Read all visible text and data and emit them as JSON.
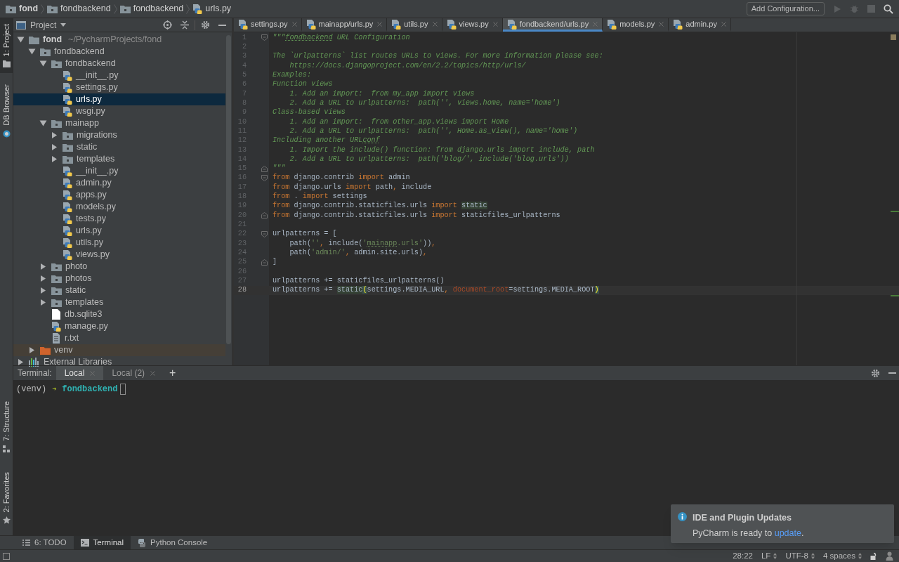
{
  "breadcrumbs": [
    {
      "label": "fond",
      "kind": "folder",
      "bold": true
    },
    {
      "label": "fondbackend",
      "kind": "module",
      "bold": false
    },
    {
      "label": "fondbackend",
      "kind": "module",
      "bold": false
    },
    {
      "label": "urls.py",
      "kind": "python",
      "bold": false
    }
  ],
  "toolbar": {
    "run_configuration": "Add Configuration..."
  },
  "left_tool_strip": {
    "top": [
      {
        "label": "1: Project",
        "kind": "project",
        "selected": true
      },
      {
        "label": "DB Browser",
        "kind": "db",
        "selected": false
      }
    ],
    "bottom": [
      {
        "label": "7: Structure",
        "kind": "structure",
        "selected": false
      },
      {
        "label": "2: Favorites",
        "kind": "favorites",
        "selected": false
      }
    ]
  },
  "project_panel": {
    "title": "Project",
    "tree": [
      {
        "label": "fond",
        "path": "~/PycharmProjects/fond",
        "kind": "root",
        "expanded": true,
        "selected": false,
        "children": [
          {
            "label": "fondbackend",
            "kind": "folder",
            "expanded": true,
            "selected": false,
            "children": [
              {
                "label": "fondbackend",
                "kind": "folder",
                "expanded": true,
                "selected": false,
                "children": [
                  {
                    "label": "__init__.py",
                    "kind": "python",
                    "selected": false
                  },
                  {
                    "label": "settings.py",
                    "kind": "python",
                    "selected": false
                  },
                  {
                    "label": "urls.py",
                    "kind": "python",
                    "selected": true
                  },
                  {
                    "label": "wsgi.py",
                    "kind": "python",
                    "selected": false
                  }
                ]
              },
              {
                "label": "mainapp",
                "kind": "folder",
                "expanded": true,
                "selected": false,
                "children": [
                  {
                    "label": "migrations",
                    "kind": "folder",
                    "expanded": false,
                    "selected": false
                  },
                  {
                    "label": "static",
                    "kind": "folder",
                    "expanded": false,
                    "selected": false
                  },
                  {
                    "label": "templates",
                    "kind": "folder",
                    "expanded": false,
                    "selected": false
                  },
                  {
                    "label": "__init__.py",
                    "kind": "python",
                    "selected": false
                  },
                  {
                    "label": "admin.py",
                    "kind": "python",
                    "selected": false
                  },
                  {
                    "label": "apps.py",
                    "kind": "python",
                    "selected": false
                  },
                  {
                    "label": "models.py",
                    "kind": "python",
                    "selected": false
                  },
                  {
                    "label": "tests.py",
                    "kind": "python",
                    "selected": false
                  },
                  {
                    "label": "urls.py",
                    "kind": "python",
                    "selected": false
                  },
                  {
                    "label": "utils.py",
                    "kind": "python",
                    "selected": false
                  },
                  {
                    "label": "views.py",
                    "kind": "python",
                    "selected": false
                  }
                ]
              },
              {
                "label": "photo",
                "kind": "folder",
                "expanded": false,
                "selected": false
              },
              {
                "label": "photos",
                "kind": "folder",
                "expanded": false,
                "selected": false
              },
              {
                "label": "static",
                "kind": "folder",
                "expanded": false,
                "selected": false
              },
              {
                "label": "templates",
                "kind": "folder",
                "expanded": false,
                "selected": false
              },
              {
                "label": "db.sqlite3",
                "kind": "file",
                "selected": false
              },
              {
                "label": "manage.py",
                "kind": "python",
                "selected": false
              },
              {
                "label": "r.txt",
                "kind": "text",
                "selected": false
              }
            ]
          },
          {
            "label": "venv",
            "kind": "excluded",
            "expanded": false,
            "selected": false
          }
        ]
      },
      {
        "label": "External Libraries",
        "kind": "library",
        "expanded": false,
        "selected": false
      }
    ]
  },
  "editor_tabs": [
    {
      "label": "settings.py",
      "selected": false
    },
    {
      "label": "mainapp/urls.py",
      "selected": false
    },
    {
      "label": "utils.py",
      "selected": false
    },
    {
      "label": "views.py",
      "selected": false
    },
    {
      "label": "fondbackend/urls.py",
      "selected": true
    },
    {
      "label": "models.py",
      "selected": false
    },
    {
      "label": "admin.py",
      "selected": false
    }
  ],
  "editor": {
    "lines": [
      {
        "number": "1",
        "fold_start": true,
        "current": false,
        "tokens": [
          {
            "kind": "doc",
            "text": "\"\"\""
          },
          {
            "kind": "doc_marked",
            "text": "fondbackend"
          },
          {
            "kind": "doc",
            "text": " URL Configuration"
          }
        ]
      },
      {
        "number": "2",
        "current": false
      },
      {
        "number": "3",
        "current": false,
        "tokens": [
          {
            "kind": "doc",
            "text": "The `urlpatterns` list routes URLs to views. For more information please see:"
          }
        ]
      },
      {
        "number": "4",
        "current": false,
        "tokens": [
          {
            "kind": "doc",
            "text": "    https://docs.djangoproject.com/en/2.2/topics/http/urls/"
          }
        ]
      },
      {
        "number": "5",
        "current": false,
        "tokens": [
          {
            "kind": "doc",
            "text": "Examples:"
          }
        ]
      },
      {
        "number": "6",
        "current": false,
        "tokens": [
          {
            "kind": "doc",
            "text": "Function views"
          }
        ]
      },
      {
        "number": "7",
        "current": false,
        "tokens": [
          {
            "kind": "doc",
            "text": "    1. Add an import:  from my_app import views"
          }
        ]
      },
      {
        "number": "8",
        "current": false,
        "tokens": [
          {
            "kind": "doc",
            "text": "    2. Add a URL to urlpatterns:  path('', views.home, name='home')"
          }
        ]
      },
      {
        "number": "9",
        "current": false,
        "tokens": [
          {
            "kind": "doc",
            "text": "Class-based views"
          }
        ]
      },
      {
        "number": "10",
        "current": false,
        "tokens": [
          {
            "kind": "doc",
            "text": "    1. Add an import:  from other_app.views import Home"
          }
        ]
      },
      {
        "number": "11",
        "current": false,
        "tokens": [
          {
            "kind": "doc",
            "text": "    2. Add a URL to urlpatterns:  path('', Home.as_view(), name='home')"
          }
        ]
      },
      {
        "number": "12",
        "current": false,
        "tokens": [
          {
            "kind": "doc",
            "text": "Including another URL"
          },
          {
            "kind": "doc_marked",
            "text": "conf"
          }
        ]
      },
      {
        "number": "13",
        "current": false,
        "tokens": [
          {
            "kind": "doc",
            "text": "    1. Import the include() function: from django.urls import include, path"
          }
        ]
      },
      {
        "number": "14",
        "current": false,
        "tokens": [
          {
            "kind": "doc",
            "text": "    2. Add a URL to urlpatterns:  path('blog/', include('blog.urls'))"
          }
        ]
      },
      {
        "number": "15",
        "fold_end": true,
        "current": false,
        "tokens": [
          {
            "kind": "doc",
            "text": "\"\"\""
          }
        ]
      },
      {
        "number": "16",
        "fold_start": true,
        "current": false,
        "tokens": [
          {
            "kind": "keyword",
            "text": "from"
          },
          {
            "kind": "plain",
            "text": " django.contrib "
          },
          {
            "kind": "keyword",
            "text": "import"
          },
          {
            "kind": "plain",
            "text": " admin"
          }
        ]
      },
      {
        "number": "17",
        "current": false,
        "tokens": [
          {
            "kind": "keyword",
            "text": "from"
          },
          {
            "kind": "plain",
            "text": " django.urls "
          },
          {
            "kind": "keyword",
            "text": "import"
          },
          {
            "kind": "plain",
            "text": " path"
          },
          {
            "kind": "keyword",
            "text": ","
          },
          {
            "kind": "plain",
            "text": " include"
          }
        ]
      },
      {
        "number": "18",
        "current": false,
        "tokens": [
          {
            "kind": "keyword",
            "text": "from"
          },
          {
            "kind": "plain",
            "text": " . "
          },
          {
            "kind": "keyword",
            "text": "import"
          },
          {
            "kind": "plain",
            "text": " settings"
          }
        ]
      },
      {
        "number": "19",
        "current": false,
        "tokens": [
          {
            "kind": "keyword",
            "text": "from"
          },
          {
            "kind": "plain",
            "text": " django.contrib.staticfiles.urls "
          },
          {
            "kind": "keyword",
            "text": "import "
          },
          {
            "kind": "usage",
            "text": "static"
          }
        ]
      },
      {
        "number": "20",
        "fold_end": true,
        "current": false,
        "tokens": [
          {
            "kind": "keyword",
            "text": "from"
          },
          {
            "kind": "plain",
            "text": " django.contrib.staticfiles.urls "
          },
          {
            "kind": "keyword",
            "text": "import"
          },
          {
            "kind": "plain",
            "text": " staticfiles_urlpatterns"
          }
        ]
      },
      {
        "number": "21",
        "current": false
      },
      {
        "number": "22",
        "fold_start": true,
        "current": false,
        "tokens": [
          {
            "kind": "plain",
            "text": "urlpatterns = ["
          }
        ]
      },
      {
        "number": "23",
        "current": false,
        "tokens": [
          {
            "kind": "plain",
            "text": "    path("
          },
          {
            "kind": "string",
            "text": "''"
          },
          {
            "kind": "keyword",
            "text": ", "
          },
          {
            "kind": "plain",
            "text": "include("
          },
          {
            "kind": "string",
            "text": "'"
          },
          {
            "kind": "string_marked",
            "text": "mainapp"
          },
          {
            "kind": "string",
            "text": ".urls'"
          },
          {
            "kind": "plain",
            "text": "))"
          },
          {
            "kind": "keyword",
            "text": ","
          }
        ]
      },
      {
        "number": "24",
        "current": false,
        "tokens": [
          {
            "kind": "plain",
            "text": "    path("
          },
          {
            "kind": "string",
            "text": "'admin/'"
          },
          {
            "kind": "keyword",
            "text": ", "
          },
          {
            "kind": "plain",
            "text": "admin.site.urls)"
          },
          {
            "kind": "keyword",
            "text": ","
          }
        ]
      },
      {
        "number": "25",
        "fold_end": true,
        "current": false,
        "tokens": [
          {
            "kind": "plain",
            "text": "]"
          }
        ]
      },
      {
        "number": "26",
        "current": false
      },
      {
        "number": "27",
        "current": false,
        "tokens": [
          {
            "kind": "plain",
            "text": "urlpatterns += staticfiles_urlpatterns()"
          }
        ]
      },
      {
        "number": "28",
        "current": true,
        "tokens": [
          {
            "kind": "plain",
            "text": "urlpatterns += "
          },
          {
            "kind": "usage",
            "text": "static"
          },
          {
            "kind": "brace",
            "text": "("
          },
          {
            "kind": "plain",
            "text": "settings.MEDIA_URL"
          },
          {
            "kind": "keyword",
            "text": ", "
          },
          {
            "kind": "param",
            "text": "document_root"
          },
          {
            "kind": "plain",
            "text": "=settings.MEDIA_ROOT"
          },
          {
            "kind": "brace",
            "text": ")"
          }
        ]
      }
    ]
  },
  "terminal": {
    "label": "Terminal:",
    "tabs": [
      {
        "label": "Local",
        "selected": true
      },
      {
        "label": "Local (2)",
        "selected": false
      }
    ],
    "new_tab": "+",
    "prompt": {
      "env": "(venv)",
      "arrow": "➜",
      "directory": "fondbackend"
    }
  },
  "bottom_tool_tabs": [
    {
      "label": "6: TODO",
      "kind": "todo",
      "selected": false
    },
    {
      "label": "Terminal",
      "kind": "terminal",
      "selected": true
    },
    {
      "label": "Python Console",
      "kind": "console",
      "selected": false
    }
  ],
  "notification": {
    "title": "IDE and Plugin Updates",
    "message": "PyCharm is ready to ",
    "link": "update",
    "message_end": "."
  },
  "status_bar": [
    {
      "text": "28:22",
      "dropdown": false
    },
    {
      "text": "LF",
      "dropdown": true
    },
    {
      "text": "UTF-8",
      "dropdown": true
    },
    {
      "text": "4 spaces",
      "dropdown": true
    }
  ]
}
